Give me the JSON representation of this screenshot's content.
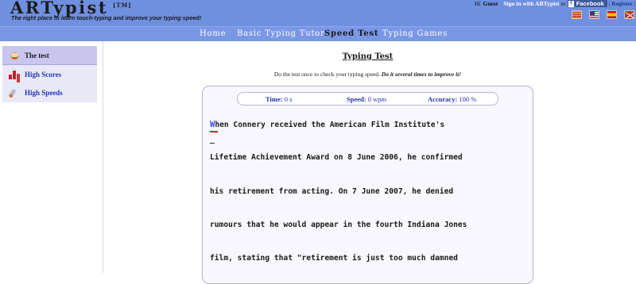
{
  "header": {
    "logo": "ARTypist",
    "tm": "[TM]",
    "tagline": "The right place to learn touch-typing and improve your typing speed!",
    "user": {
      "greeting": "Hi",
      "name": "Guest",
      "signin": "Sign in with ARTypist",
      "or": "or",
      "facebook": "Facebook",
      "separator": "|",
      "register": "Register",
      "end_separator": "|"
    },
    "flags": [
      "catalan-flag",
      "us-flag",
      "spain-flag",
      "basque-flag"
    ]
  },
  "nav": {
    "items": [
      {
        "label": "Home"
      },
      {
        "label": "Basic Typing Tutor"
      },
      {
        "label": "Speed Test"
      },
      {
        "label": "Typing Games"
      }
    ],
    "active": "Speed Test"
  },
  "sidebar": {
    "items": [
      {
        "label": "The test",
        "icon": "keyboard-icon"
      },
      {
        "label": "High Scores",
        "icon": "bar-chart-icon"
      },
      {
        "label": "High Speeds",
        "icon": "rocket-icon"
      }
    ]
  },
  "main": {
    "title": "Typing Test",
    "intro": "Do the test once to check your typing speed.",
    "intro_emphasis": "Do it several times to improve it!",
    "stats": {
      "time_label": "Time:",
      "time_value": "0 s",
      "speed_label": "Speed:",
      "speed_value": "0 wpm",
      "accuracy_label": "Accuracy:",
      "accuracy_value": "100 %"
    },
    "current_char": "W",
    "lines": [
      "hen Connery received the American Film Institute's",
      "Lifetime Achievement Award on 8 June 2006, he confirmed",
      "his retirement from acting. On 7 June 2007, he denied",
      "rumours that he would appear in the fourth Indiana Jones",
      "film, stating that \"retirement is just too much damned"
    ]
  },
  "colors": {
    "header_bg": "#6f8fe0",
    "nav_bg": "#7a97e6",
    "sidebar_active": "#c8c6ef",
    "link": "#2036b8",
    "cursor": "#e02020"
  }
}
